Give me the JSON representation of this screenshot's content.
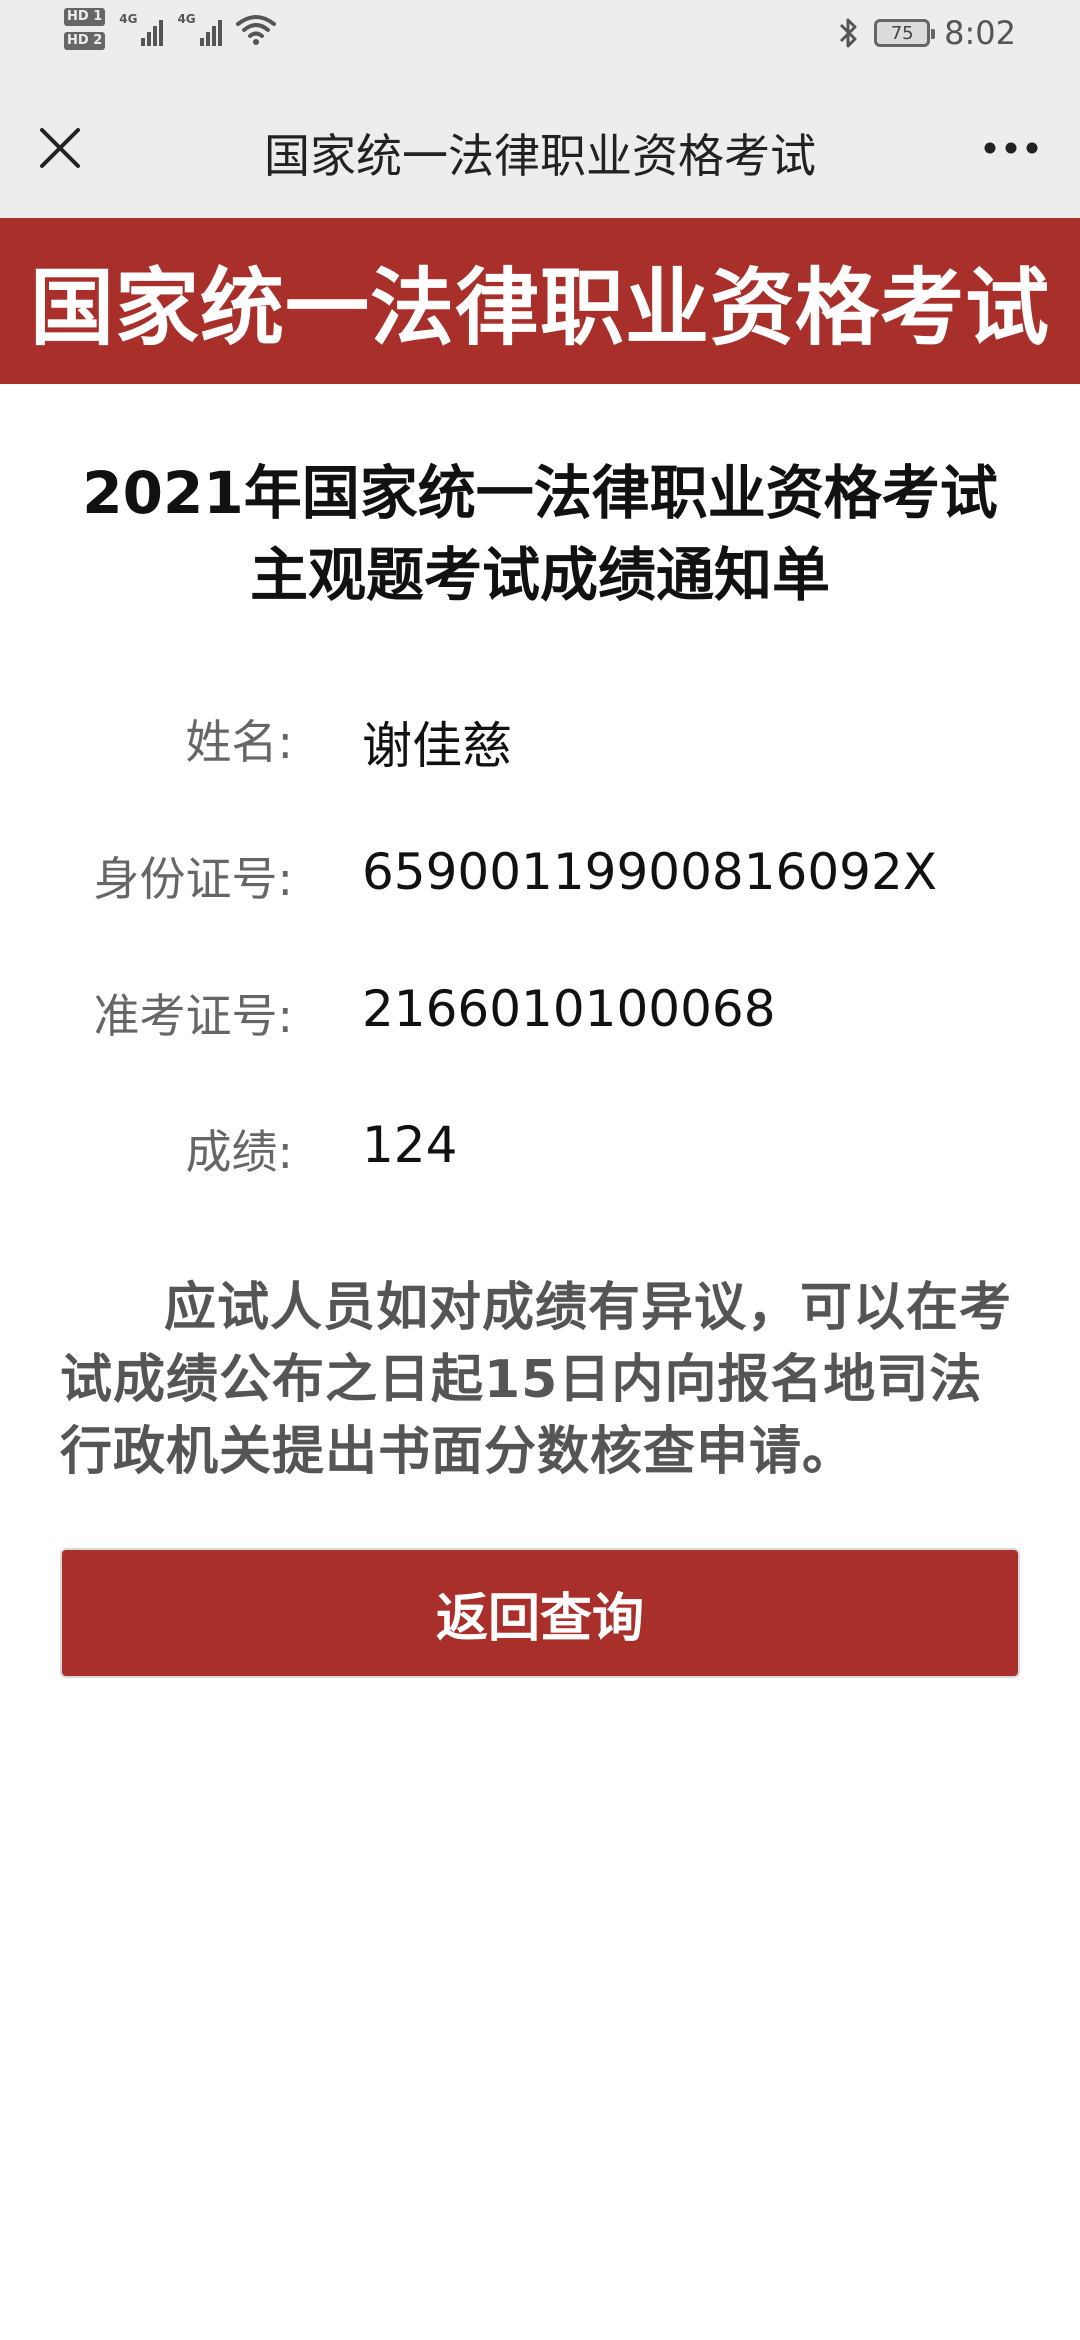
{
  "status_bar": {
    "sim1_label": "HD 1",
    "sim2_label": "HD 2",
    "network1": "4G",
    "network2": "4G",
    "battery_level": "75",
    "time": "8:02",
    "icons": [
      "signal-icon",
      "wifi-icon",
      "bluetooth-icon",
      "battery-icon"
    ]
  },
  "nav": {
    "title": "国家统一法律职业资格考试",
    "close_icon": "close-icon",
    "more_icon": "more-icon"
  },
  "banner": {
    "title": "国家统一法律职业资格考试"
  },
  "document": {
    "title_line1": "2021年国家统一法律职业资格考试",
    "title_line2": "主观题考试成绩通知单",
    "fields": [
      {
        "label": "姓名:",
        "value": "谢佳慈"
      },
      {
        "label": "身份证号:",
        "value": "65900119900816092X"
      },
      {
        "label": "准考证号:",
        "value": "2166010100068"
      },
      {
        "label": "成绩:",
        "value": "124"
      }
    ],
    "notice": "应试人员如对成绩有异议，可以在考试成绩公布之日起15日内向报名地司法行政机关提出书面分数核查申请。"
  },
  "actions": {
    "return_label": "返回查询"
  },
  "colors": {
    "brand_red": "#a9302a",
    "nav_background": "#ededed"
  }
}
